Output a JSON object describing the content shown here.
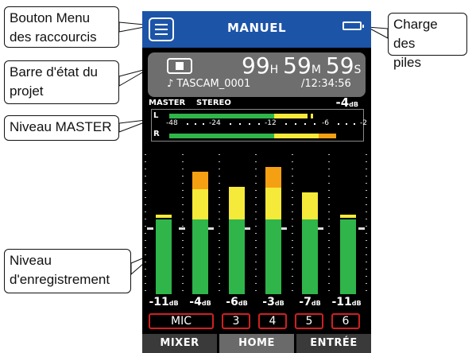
{
  "callouts": {
    "menu": [
      "Bouton Menu",
      "des raccourcis"
    ],
    "status": [
      "Barre d'état du",
      "projet"
    ],
    "master": [
      "Niveau MASTER"
    ],
    "rec": [
      "Niveau",
      "d'enregistrement"
    ],
    "battery": [
      "Charge des",
      "piles"
    ]
  },
  "screen": {
    "title": "MANUEL",
    "time": {
      "hours": "99",
      "h_unit": "H",
      "minutes": "59",
      "m_unit": "M",
      "seconds": "59",
      "s_unit": "S"
    },
    "filename": "♪ TASCAM_0001",
    "total": "/12:34:56",
    "master": {
      "label": "MASTER",
      "mode": "STEREO",
      "db": "-4",
      "db_unit": "dB",
      "ch_l": "L",
      "ch_r": "R",
      "scale": [
        "-48",
        "-24",
        "-12",
        "-6",
        "-2",
        "0"
      ]
    },
    "channels": [
      {
        "db": "-11",
        "input": "MIC"
      },
      {
        "db": "-4",
        "input": "3"
      },
      {
        "db": "-6",
        "input": "4"
      },
      {
        "db": "-3",
        "input": "5"
      },
      {
        "db": "-7",
        "input": "6"
      },
      {
        "db": "-11",
        "input": ""
      }
    ],
    "db_unit": "dB",
    "tabs": [
      "MIXER",
      "HOME",
      "ENTRÉE"
    ]
  },
  "colors": {
    "title_bar": "#1c54a8",
    "green": "#2fb54a",
    "yellow": "#f5e93a",
    "orange": "#f5a013",
    "peak": "#f5e93a",
    "input_border": "#d02020",
    "tab_bg": "#3a3a3a",
    "tab_active": "#6a6a6a"
  }
}
